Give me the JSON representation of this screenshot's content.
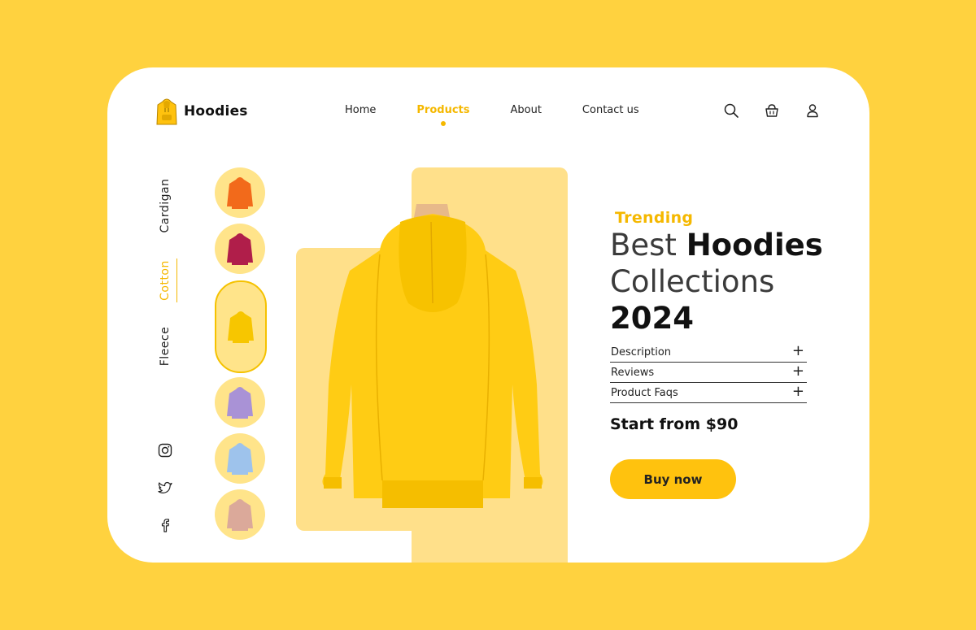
{
  "brand": {
    "name": "Hoodies",
    "icon": "hoodie-logo-icon"
  },
  "nav": {
    "items": [
      {
        "label": "Home",
        "active": false
      },
      {
        "label": "Products",
        "active": true
      },
      {
        "label": "About",
        "active": false
      },
      {
        "label": "Contact us",
        "active": false
      }
    ]
  },
  "header_icons": [
    "search-icon",
    "basket-icon",
    "user-icon"
  ],
  "categories": [
    {
      "label": "Cardigan",
      "active": false
    },
    {
      "label": "Cotton",
      "active": true
    },
    {
      "label": "Fleece",
      "active": false
    }
  ],
  "social": [
    "instagram-icon",
    "twitter-icon",
    "facebook-icon"
  ],
  "thumbnails": [
    {
      "color": "#F26A1B",
      "active": false
    },
    {
      "color": "#B01E4A",
      "active": false
    },
    {
      "color": "#F7C600",
      "active": true
    },
    {
      "color": "#A992D6",
      "active": false
    },
    {
      "color": "#9EC3EC",
      "active": false
    },
    {
      "color": "#DBA99A",
      "active": false
    }
  ],
  "hero": {
    "tag": "Trending",
    "line1_light": "Best",
    "line1_bold": "Hoodies",
    "line2": "Collections",
    "line3": "2024"
  },
  "accordion": [
    {
      "label": "Description"
    },
    {
      "label": "Reviews"
    },
    {
      "label": "Product Faqs"
    }
  ],
  "accordion_icon": "+",
  "price_text": "Start from $90",
  "buy_label": "Buy now",
  "colors": {
    "accent": "#F5B800",
    "page_bg": "#FFD23F",
    "panel": "#FFE08A"
  }
}
